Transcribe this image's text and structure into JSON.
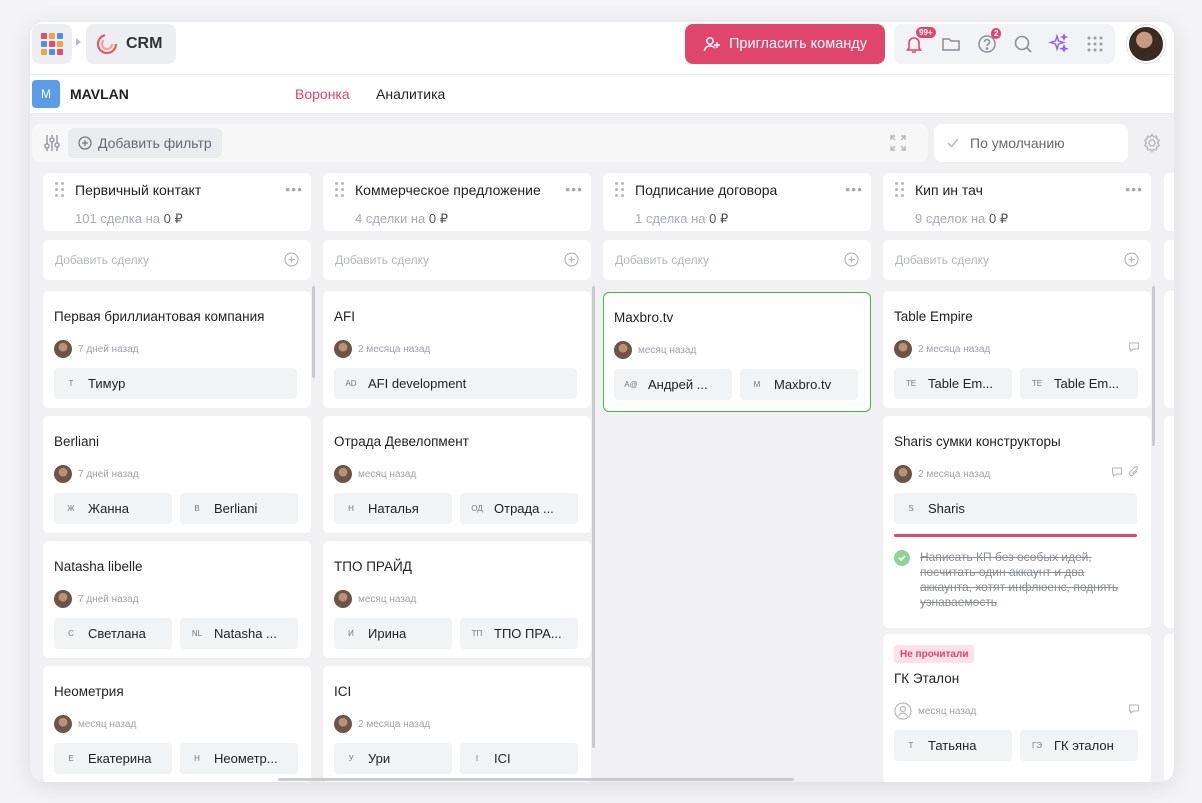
{
  "topbar": {
    "app_name": "CRM",
    "invite_label": "Пригласить команду",
    "notifications_badge": "99+",
    "help_badge": "2",
    "brand_color": "#e0456c"
  },
  "project": {
    "initial": "M",
    "name": "MAVLAN",
    "tabs": [
      {
        "label": "Воронка",
        "active": true
      },
      {
        "label": "Аналитика",
        "active": false
      }
    ]
  },
  "filters": {
    "add_filter_label": "Добавить фильтр",
    "sort_label": "По умолчанию"
  },
  "add_deal_label": "Добавить сделку",
  "columns": [
    {
      "title": "Первичный контакт",
      "count_text": "101 сделка на",
      "amount": "0 ₽",
      "cards": [
        {
          "title": "Первая бриллиантовая компания",
          "time": "7 дней назад",
          "chips": [
            {
              "init": "Т",
              "label": "Тимур"
            }
          ]
        },
        {
          "title": "Berliani",
          "time": "7 дней назад",
          "chips": [
            {
              "init": "Ж",
              "label": "Жанна"
            },
            {
              "init": "B",
              "label": "Berliani"
            }
          ]
        },
        {
          "title": "Natasha libelle",
          "time": "7 дней назад",
          "chips": [
            {
              "init": "С",
              "label": "Светлана"
            },
            {
              "init": "NL",
              "label": "Natasha ..."
            }
          ]
        },
        {
          "title": "Неометрия",
          "time": "месяц назад",
          "chips": [
            {
              "init": "Е",
              "label": "Екатерина"
            },
            {
              "init": "Н",
              "label": "Неометр..."
            }
          ]
        }
      ]
    },
    {
      "title": "Коммерческое предложение",
      "count_text": "4 сделки на",
      "amount": "0 ₽",
      "cards": [
        {
          "title": "AFI",
          "time": "2 месяца назад",
          "chips": [
            {
              "init": "AD",
              "label": "AFI development"
            }
          ]
        },
        {
          "title": "Отрада Девелопмент",
          "time": "месяц назад",
          "chips": [
            {
              "init": "Н",
              "label": "Наталья"
            },
            {
              "init": "ОД",
              "label": "Отрада ..."
            }
          ]
        },
        {
          "title": "ТПО ПРАЙД",
          "time": "месяц назад",
          "chips": [
            {
              "init": "И",
              "label": "Ирина"
            },
            {
              "init": "ТП",
              "label": "ТПО ПРА..."
            }
          ]
        },
        {
          "title": "ICI",
          "time": "2 месяца назад",
          "chips": [
            {
              "init": "У",
              "label": "Ури"
            },
            {
              "init": "I",
              "label": "ICI"
            }
          ]
        }
      ]
    },
    {
      "title": "Подписание договора",
      "count_text": "1 сделка на",
      "amount": "0 ₽",
      "cards": [
        {
          "title": "Maxbro.tv",
          "time": "месяц назад",
          "chips": [
            {
              "init": "А@",
              "label": "Андрей ..."
            },
            {
              "init": "M",
              "label": "Maxbro.tv"
            }
          ]
        }
      ]
    },
    {
      "title": "Кип ин тач",
      "count_text": "9 сделок на",
      "amount": "0 ₽",
      "cards": [
        {
          "title": "Table Empire",
          "time": "2 месяца назад",
          "chips": [
            {
              "init": "TE",
              "label": "Table Em..."
            },
            {
              "init": "TE",
              "label": "Table Em..."
            }
          ]
        },
        {
          "title": "Sharis сумки конструкторы",
          "time": "2 месяца назад",
          "chips": [
            {
              "init": "S",
              "label": "Sharis"
            }
          ],
          "task": "Написать КП без особых идей, посчитать один аккаунт и два аккаунта, хотят инфлюенс, поднять узнаваемость"
        },
        {
          "title": "ГК Эталон",
          "time": "месяц назад",
          "unread": "Не прочитали",
          "chips": [
            {
              "init": "Т",
              "label": "Татьяна"
            },
            {
              "init": "ГЭ",
              "label": "ГК эталон"
            }
          ]
        }
      ]
    }
  ]
}
